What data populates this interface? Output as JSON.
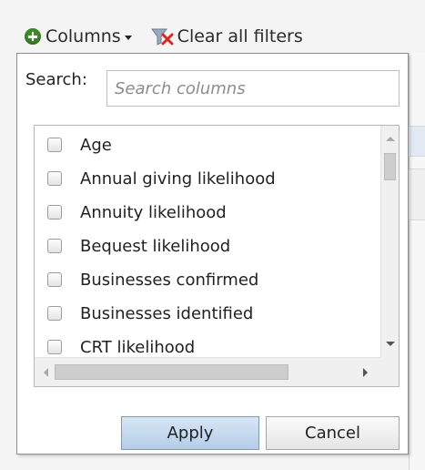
{
  "toolbar": {
    "columns_label": "Columns",
    "clear_filters_label": "Clear all filters",
    "icons": {
      "add": "plus-circle-icon",
      "dropdown": "caret-down-icon",
      "clear_filter": "filter-clear-icon"
    }
  },
  "search": {
    "label": "Search:",
    "value": "",
    "placeholder": "Search columns"
  },
  "columns": [
    {
      "label": "Age",
      "checked": false
    },
    {
      "label": "Annual giving likelihood",
      "checked": false
    },
    {
      "label": "Annuity likelihood",
      "checked": false
    },
    {
      "label": "Bequest likelihood",
      "checked": false
    },
    {
      "label": "Businesses confirmed",
      "checked": false
    },
    {
      "label": "Businesses identified",
      "checked": false
    },
    {
      "label": "CRT likelihood",
      "checked": false
    }
  ],
  "buttons": {
    "apply": "Apply",
    "cancel": "Cancel"
  },
  "colors": {
    "add_icon": "#3d8b27",
    "apply_button": "#b5cde8",
    "popup_border": "#8f8f8f"
  }
}
